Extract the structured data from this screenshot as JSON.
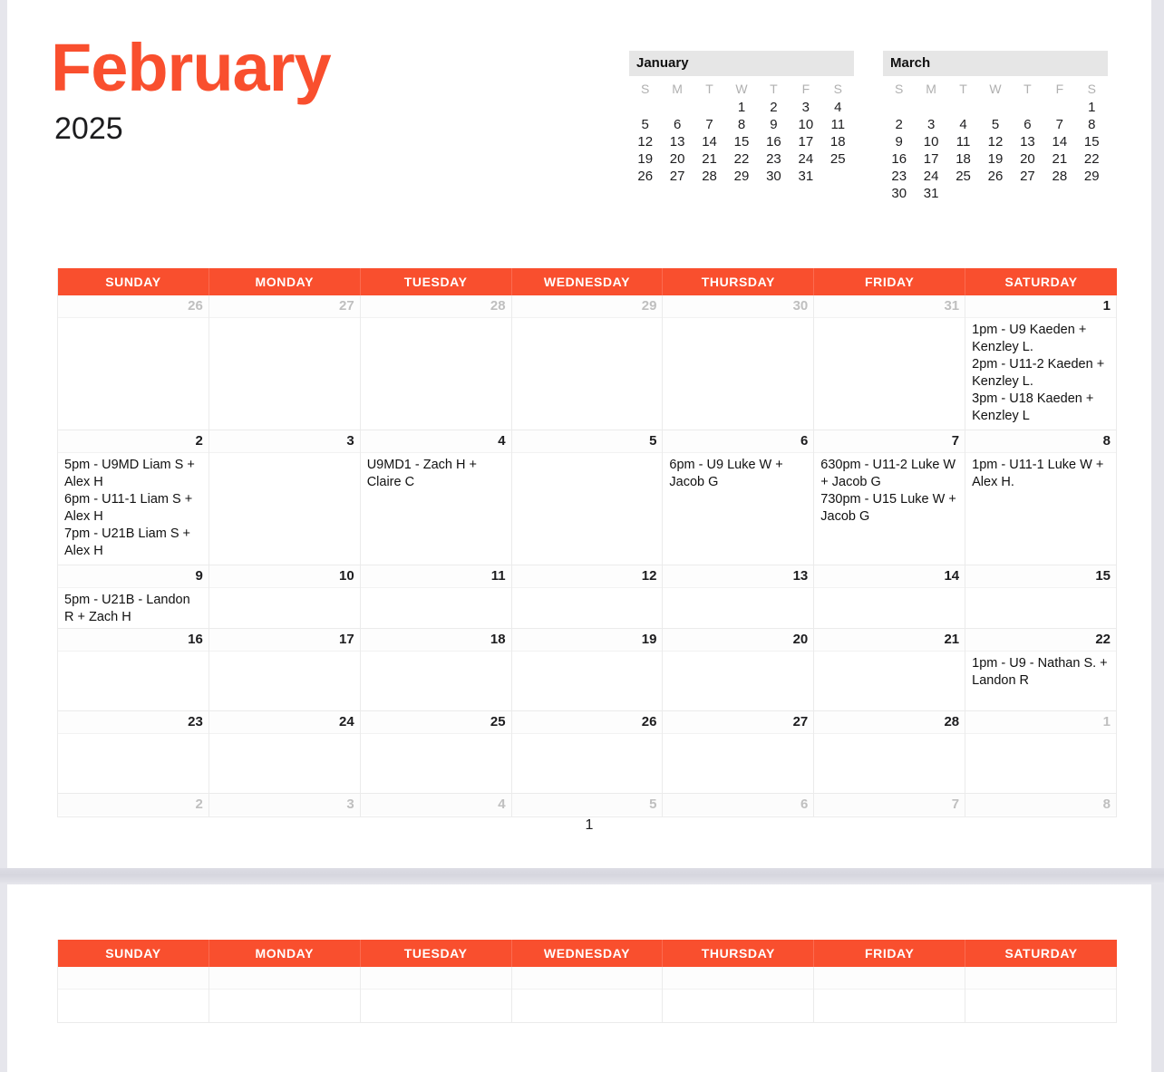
{
  "document": {
    "month": "February",
    "year": "2025",
    "page_number": "1",
    "accent_color": "#F94F2E",
    "header_text_color": "#FFFFFF"
  },
  "mini_calendars": [
    {
      "name": "january-mini-calendar",
      "title": "January",
      "dow": [
        "S",
        "M",
        "T",
        "W",
        "T",
        "F",
        "S"
      ],
      "weeks": [
        [
          "",
          "",
          "",
          "1",
          "2",
          "3",
          "4"
        ],
        [
          "5",
          "6",
          "7",
          "8",
          "9",
          "10",
          "11"
        ],
        [
          "12",
          "13",
          "14",
          "15",
          "16",
          "17",
          "18"
        ],
        [
          "19",
          "20",
          "21",
          "22",
          "23",
          "24",
          "25"
        ],
        [
          "26",
          "27",
          "28",
          "29",
          "30",
          "31",
          ""
        ]
      ]
    },
    {
      "name": "march-mini-calendar",
      "title": "March",
      "dow": [
        "S",
        "M",
        "T",
        "W",
        "T",
        "F",
        "S"
      ],
      "weeks": [
        [
          "",
          "",
          "",
          "",
          "",
          "",
          "1"
        ],
        [
          "2",
          "3",
          "4",
          "5",
          "6",
          "7",
          "8"
        ],
        [
          "9",
          "10",
          "11",
          "12",
          "13",
          "14",
          "15"
        ],
        [
          "16",
          "17",
          "18",
          "19",
          "20",
          "21",
          "22"
        ],
        [
          "23",
          "24",
          "25",
          "26",
          "27",
          "28",
          "29"
        ],
        [
          "30",
          "31",
          "",
          "",
          "",
          "",
          ""
        ]
      ]
    }
  ],
  "calendar": {
    "weekday_headers": [
      "SUNDAY",
      "MONDAY",
      "TUESDAY",
      "WEDNESDAY",
      "THURSDAY",
      "FRIDAY",
      "SATURDAY"
    ],
    "weeks": [
      {
        "row": 1,
        "days": [
          {
            "num": "26",
            "other_month": true,
            "events": []
          },
          {
            "num": "27",
            "other_month": true,
            "events": []
          },
          {
            "num": "28",
            "other_month": true,
            "events": []
          },
          {
            "num": "29",
            "other_month": true,
            "events": []
          },
          {
            "num": "30",
            "other_month": true,
            "events": []
          },
          {
            "num": "31",
            "other_month": true,
            "events": []
          },
          {
            "num": "1",
            "other_month": false,
            "events": [
              "1pm - U9 Kaeden + Kenzley L.",
              "2pm - U11-2 Kaeden + Kenzley L.",
              "3pm - U18 Kaeden + Kenzley L"
            ]
          }
        ]
      },
      {
        "row": 2,
        "days": [
          {
            "num": "2",
            "other_month": false,
            "events": [
              "5pm - U9MD Liam S + Alex H",
              "6pm - U11-1 Liam S + Alex H",
              "7pm - U21B Liam S + Alex H"
            ]
          },
          {
            "num": "3",
            "other_month": false,
            "events": []
          },
          {
            "num": "4",
            "other_month": false,
            "events": [
              "U9MD1 - Zach H + Claire C"
            ]
          },
          {
            "num": "5",
            "other_month": false,
            "events": []
          },
          {
            "num": "6",
            "other_month": false,
            "events": [
              "6pm - U9 Luke W + Jacob G"
            ]
          },
          {
            "num": "7",
            "other_month": false,
            "events": [
              "630pm - U11-2 Luke W + Jacob G",
              "730pm - U15 Luke W + Jacob G"
            ]
          },
          {
            "num": "8",
            "other_month": false,
            "events": [
              "1pm - U11-1 Luke W + Alex H."
            ]
          }
        ]
      },
      {
        "row": 3,
        "days": [
          {
            "num": "9",
            "other_month": false,
            "events": [
              "5pm - U21B - Landon R + Zach H"
            ]
          },
          {
            "num": "10",
            "other_month": false,
            "events": []
          },
          {
            "num": "11",
            "other_month": false,
            "events": []
          },
          {
            "num": "12",
            "other_month": false,
            "events": []
          },
          {
            "num": "13",
            "other_month": false,
            "events": []
          },
          {
            "num": "14",
            "other_month": false,
            "events": []
          },
          {
            "num": "15",
            "other_month": false,
            "events": []
          }
        ]
      },
      {
        "row": 4,
        "days": [
          {
            "num": "16",
            "other_month": false,
            "events": []
          },
          {
            "num": "17",
            "other_month": false,
            "events": []
          },
          {
            "num": "18",
            "other_month": false,
            "events": []
          },
          {
            "num": "19",
            "other_month": false,
            "events": []
          },
          {
            "num": "20",
            "other_month": false,
            "events": []
          },
          {
            "num": "21",
            "other_month": false,
            "events": []
          },
          {
            "num": "22",
            "other_month": false,
            "events": [
              "1pm - U9 - Nathan S. + Landon R"
            ]
          }
        ]
      },
      {
        "row": 5,
        "days": [
          {
            "num": "23",
            "other_month": false,
            "events": []
          },
          {
            "num": "24",
            "other_month": false,
            "events": []
          },
          {
            "num": "25",
            "other_month": false,
            "events": []
          },
          {
            "num": "26",
            "other_month": false,
            "events": []
          },
          {
            "num": "27",
            "other_month": false,
            "events": []
          },
          {
            "num": "28",
            "other_month": false,
            "events": []
          },
          {
            "num": "1",
            "other_month": true,
            "events": []
          }
        ]
      },
      {
        "row": 6,
        "days": [
          {
            "num": "2",
            "other_month": true,
            "events": []
          },
          {
            "num": "3",
            "other_month": true,
            "events": []
          },
          {
            "num": "4",
            "other_month": true,
            "events": []
          },
          {
            "num": "5",
            "other_month": true,
            "events": []
          },
          {
            "num": "6",
            "other_month": true,
            "events": []
          },
          {
            "num": "7",
            "other_month": true,
            "events": []
          },
          {
            "num": "8",
            "other_month": true,
            "events": []
          }
        ]
      }
    ]
  },
  "second_page": {
    "weekday_headers": [
      "SUNDAY",
      "MONDAY",
      "TUESDAY",
      "WEDNESDAY",
      "THURSDAY",
      "FRIDAY",
      "SATURDAY"
    ],
    "weeks": [
      {
        "days": [
          {
            "num": "",
            "events": []
          },
          {
            "num": "",
            "events": []
          },
          {
            "num": "",
            "events": []
          },
          {
            "num": "",
            "events": []
          },
          {
            "num": "",
            "events": []
          },
          {
            "num": "",
            "events": []
          },
          {
            "num": "",
            "events": []
          }
        ]
      }
    ]
  }
}
